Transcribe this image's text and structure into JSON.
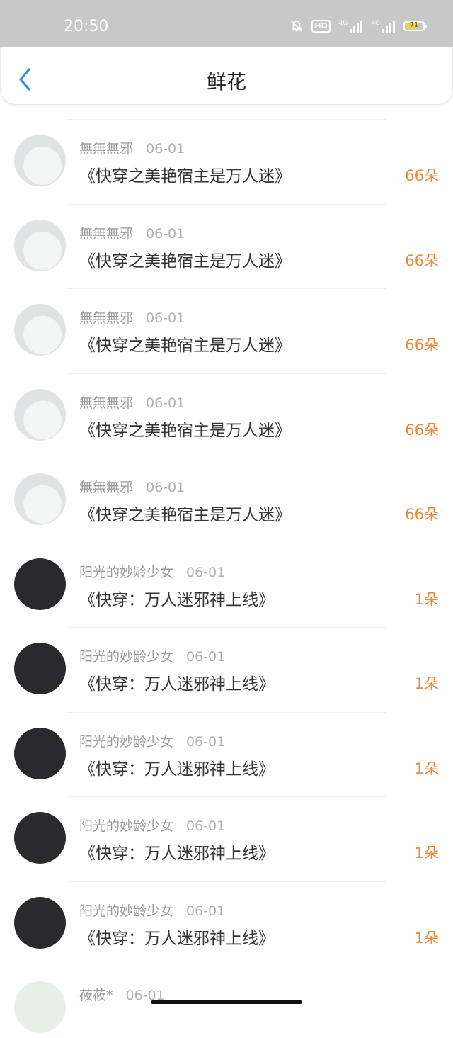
{
  "status_bar": {
    "time": "20:50",
    "hd_label": "HD",
    "network_1": "4G",
    "network_2": "4G",
    "battery_percent": "71",
    "battery_level": 0.71
  },
  "header": {
    "title": "鲜花"
  },
  "records": [
    {
      "user": "無無無邪",
      "date": "06-01",
      "book": "《快穿之美艳宿主是万人迷》",
      "amount": "66朵",
      "avatar": "anime"
    },
    {
      "user": "無無無邪",
      "date": "06-01",
      "book": "《快穿之美艳宿主是万人迷》",
      "amount": "66朵",
      "avatar": "anime"
    },
    {
      "user": "無無無邪",
      "date": "06-01",
      "book": "《快穿之美艳宿主是万人迷》",
      "amount": "66朵",
      "avatar": "anime"
    },
    {
      "user": "無無無邪",
      "date": "06-01",
      "book": "《快穿之美艳宿主是万人迷》",
      "amount": "66朵",
      "avatar": "anime"
    },
    {
      "user": "無無無邪",
      "date": "06-01",
      "book": "《快穿之美艳宿主是万人迷》",
      "amount": "66朵",
      "avatar": "anime"
    },
    {
      "user": "阳光的妙龄少女",
      "date": "06-01",
      "book": "《快穿：万人迷邪神上线》",
      "amount": "1朵",
      "avatar": "dark"
    },
    {
      "user": "阳光的妙龄少女",
      "date": "06-01",
      "book": "《快穿：万人迷邪神上线》",
      "amount": "1朵",
      "avatar": "dark"
    },
    {
      "user": "阳光的妙龄少女",
      "date": "06-01",
      "book": "《快穿：万人迷邪神上线》",
      "amount": "1朵",
      "avatar": "dark"
    },
    {
      "user": "阳光的妙龄少女",
      "date": "06-01",
      "book": "《快穿：万人迷邪神上线》",
      "amount": "1朵",
      "avatar": "dark"
    },
    {
      "user": "阳光的妙龄少女",
      "date": "06-01",
      "book": "《快穿：万人迷邪神上线》",
      "amount": "1朵",
      "avatar": "dark"
    },
    {
      "user": "莜莜*",
      "date": "06-01",
      "book": "",
      "amount": "",
      "avatar": "light"
    }
  ],
  "colors": {
    "accent_back": "#2f8fe0",
    "amount": "#f0883a",
    "status_bar_bg": "#c8c8c8"
  },
  "icons": {
    "back": "chevron-left-icon",
    "mute": "bell-off-icon",
    "signal": "signal-icon",
    "battery": "battery-icon"
  }
}
